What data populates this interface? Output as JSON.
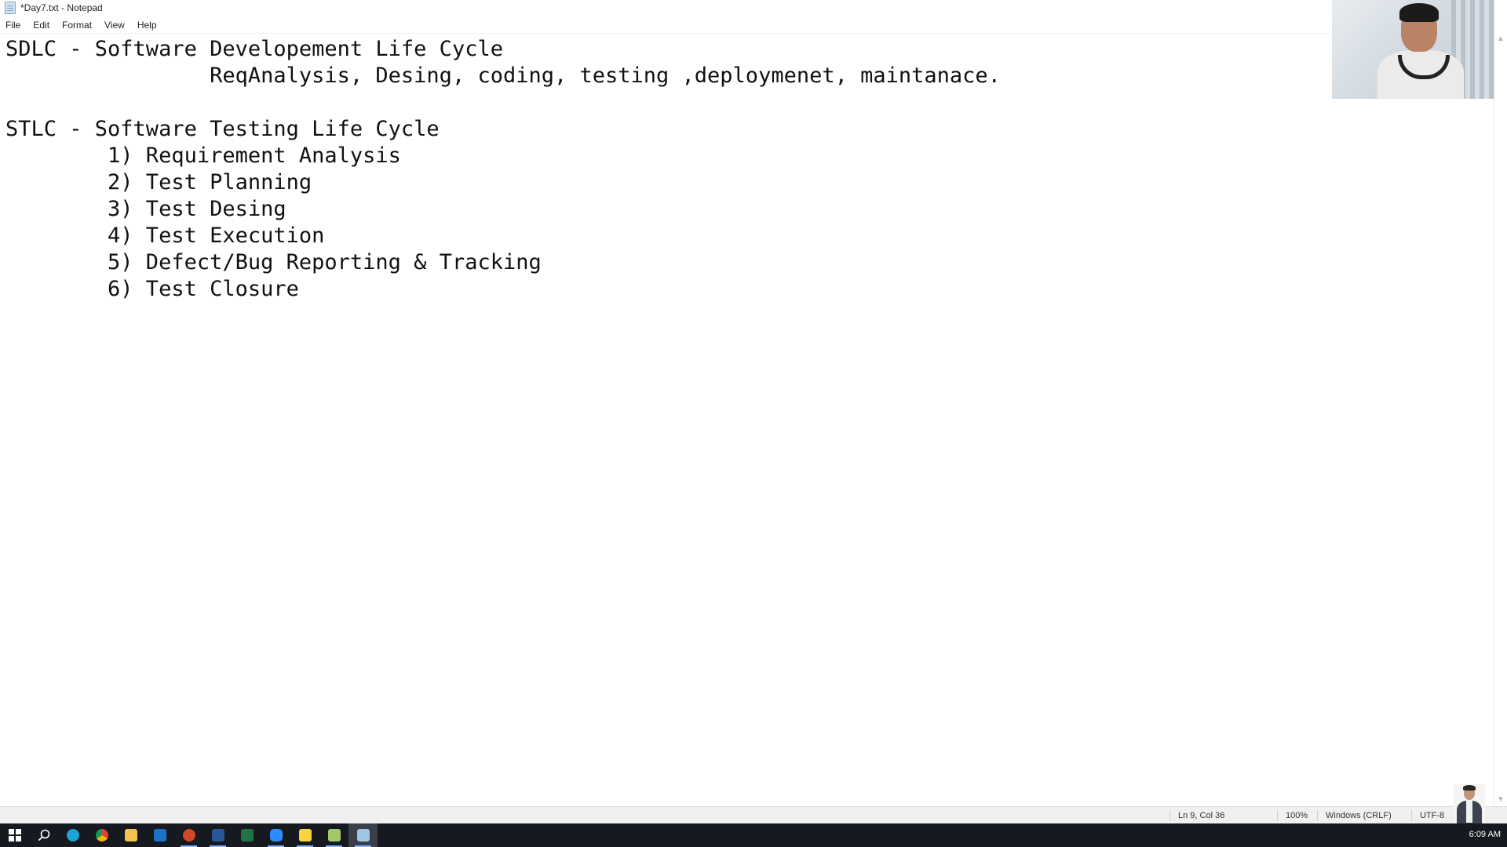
{
  "window": {
    "title": "*Day7.txt - Notepad"
  },
  "menu": {
    "items": [
      "File",
      "Edit",
      "Format",
      "View",
      "Help"
    ]
  },
  "editor": {
    "lines": [
      "SDLC - Software Developement Life Cycle",
      "                ReqAnalysis, Desing, coding, testing ,deploymenet, maintanace.",
      "",
      "STLC - Software Testing Life Cycle",
      "        1) Requirement Analysis",
      "        2) Test Planning",
      "        3) Test Desing",
      "        4) Test Execution",
      "        5) Defect/Bug Reporting & Tracking",
      "        6) Test Closure"
    ]
  },
  "statusbar": {
    "position": "Ln 9, Col 36",
    "zoom": "100%",
    "line_ending": "Windows (CRLF)",
    "encoding": "UTF-8"
  },
  "taskbar": {
    "apps": [
      {
        "icon": "windows-start-icon",
        "color": "#ffffff"
      },
      {
        "icon": "search-icon",
        "color": "#ffffff"
      },
      {
        "icon": "edge-icon",
        "color": "#1fa2d6"
      },
      {
        "icon": "chrome-icon",
        "color": "#f4b400"
      },
      {
        "icon": "file-explorer-icon",
        "color": "#f2c14e"
      },
      {
        "icon": "outlook-icon",
        "color": "#1a73c8"
      },
      {
        "icon": "powerpoint-icon",
        "color": "#d24726"
      },
      {
        "icon": "word-icon",
        "color": "#2b579a"
      },
      {
        "icon": "excel-icon",
        "color": "#217346"
      },
      {
        "icon": "zoom-icon",
        "color": "#2d8cff"
      },
      {
        "icon": "sticky-notes-icon",
        "color": "#f7d33c"
      },
      {
        "icon": "notepad-plus-icon",
        "color": "#a3c86a"
      },
      {
        "icon": "notepad-icon",
        "color": "#9fc7e3"
      }
    ],
    "clock": "6:09 AM"
  }
}
